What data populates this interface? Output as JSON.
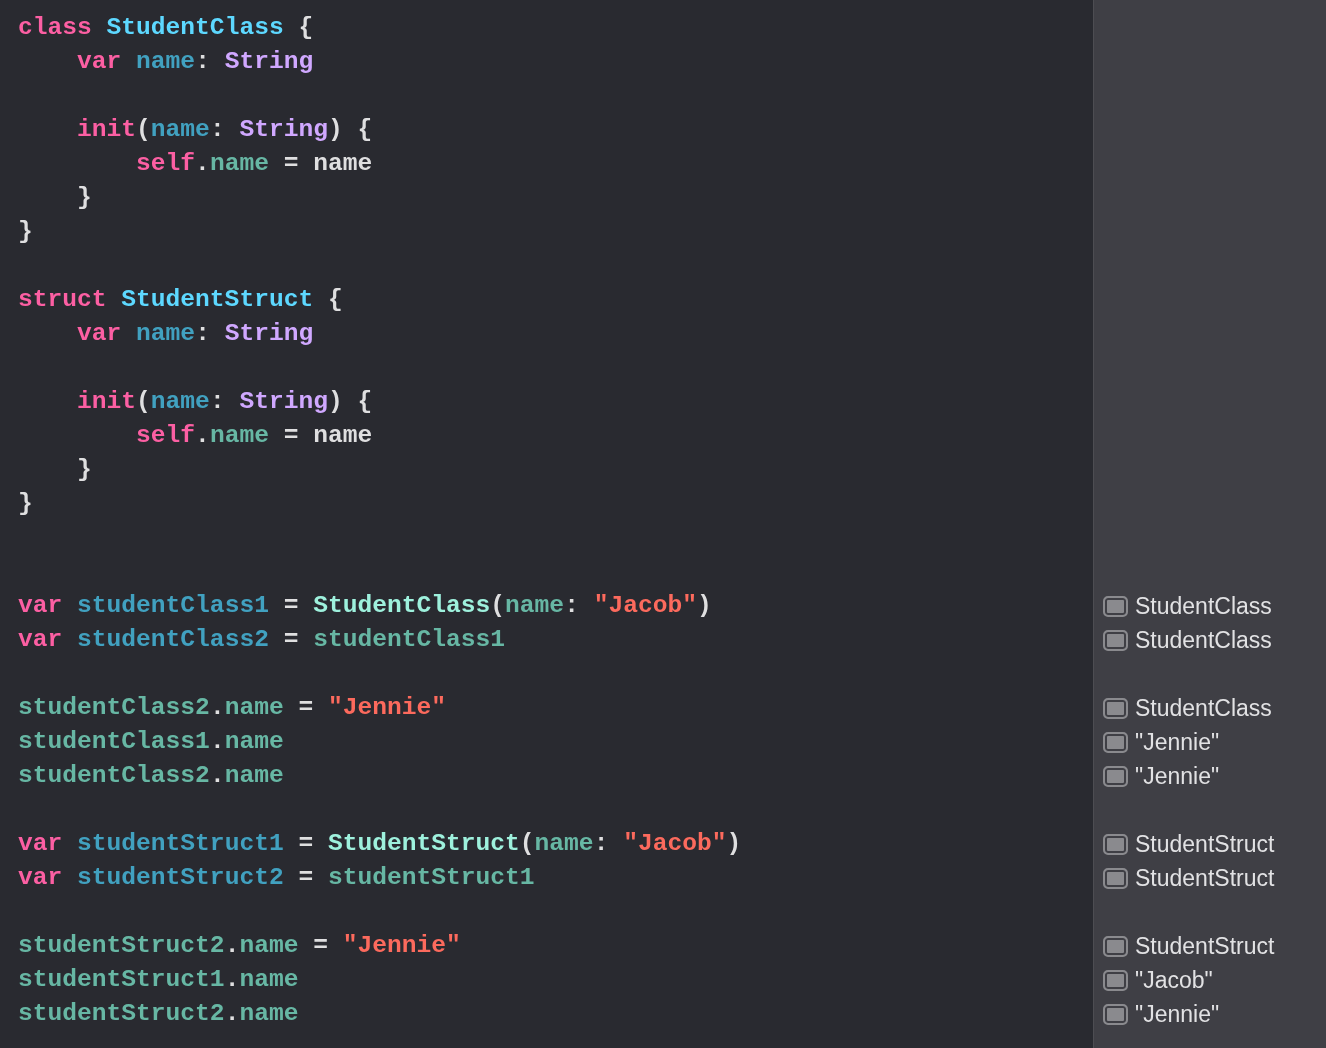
{
  "editor": {
    "lines": [
      {
        "kind": "code",
        "tokens": [
          {
            "text": "class ",
            "kind": "keyword"
          },
          {
            "text": "StudentClass",
            "kind": "typedecl"
          },
          {
            "text": " {",
            "kind": "plain"
          }
        ]
      },
      {
        "kind": "code",
        "tokens": [
          {
            "text": "    var ",
            "kind": "keyword"
          },
          {
            "text": "name",
            "kind": "decl"
          },
          {
            "text": ": ",
            "kind": "plain"
          },
          {
            "text": "String",
            "kind": "type"
          }
        ]
      },
      {
        "kind": "blank"
      },
      {
        "kind": "code",
        "tokens": [
          {
            "text": "    init",
            "kind": "keyword"
          },
          {
            "text": "(",
            "kind": "plain"
          },
          {
            "text": "name",
            "kind": "decl"
          },
          {
            "text": ": ",
            "kind": "plain"
          },
          {
            "text": "String",
            "kind": "type"
          },
          {
            "text": ") {",
            "kind": "plain"
          }
        ]
      },
      {
        "kind": "code",
        "tokens": [
          {
            "text": "        self",
            "kind": "keyword"
          },
          {
            "text": ".",
            "kind": "plain"
          },
          {
            "text": "name",
            "kind": "ref"
          },
          {
            "text": " = name",
            "kind": "plain"
          }
        ]
      },
      {
        "kind": "code",
        "tokens": [
          {
            "text": "    }",
            "kind": "plain"
          }
        ]
      },
      {
        "kind": "code",
        "tokens": [
          {
            "text": "}",
            "kind": "plain"
          }
        ]
      },
      {
        "kind": "blank"
      },
      {
        "kind": "code",
        "tokens": [
          {
            "text": "struct ",
            "kind": "keyword"
          },
          {
            "text": "StudentStruct",
            "kind": "typedecl"
          },
          {
            "text": " {",
            "kind": "plain"
          }
        ]
      },
      {
        "kind": "code",
        "tokens": [
          {
            "text": "    var ",
            "kind": "keyword"
          },
          {
            "text": "name",
            "kind": "decl"
          },
          {
            "text": ": ",
            "kind": "plain"
          },
          {
            "text": "String",
            "kind": "type"
          }
        ]
      },
      {
        "kind": "blank"
      },
      {
        "kind": "code",
        "tokens": [
          {
            "text": "    init",
            "kind": "keyword"
          },
          {
            "text": "(",
            "kind": "plain"
          },
          {
            "text": "name",
            "kind": "decl"
          },
          {
            "text": ": ",
            "kind": "plain"
          },
          {
            "text": "String",
            "kind": "type"
          },
          {
            "text": ") {",
            "kind": "plain"
          }
        ]
      },
      {
        "kind": "code",
        "tokens": [
          {
            "text": "        self",
            "kind": "keyword"
          },
          {
            "text": ".",
            "kind": "plain"
          },
          {
            "text": "name",
            "kind": "ref"
          },
          {
            "text": " = name",
            "kind": "plain"
          }
        ]
      },
      {
        "kind": "code",
        "tokens": [
          {
            "text": "    }",
            "kind": "plain"
          }
        ]
      },
      {
        "kind": "code",
        "tokens": [
          {
            "text": "}",
            "kind": "plain"
          }
        ]
      },
      {
        "kind": "blank"
      },
      {
        "kind": "blank"
      },
      {
        "kind": "code",
        "tokens": [
          {
            "text": "var ",
            "kind": "keyword"
          },
          {
            "text": "studentClass1",
            "kind": "decl"
          },
          {
            "text": " = ",
            "kind": "plain"
          },
          {
            "text": "StudentClass",
            "kind": "call"
          },
          {
            "text": "(",
            "kind": "plain"
          },
          {
            "text": "name",
            "kind": "ref"
          },
          {
            "text": ": ",
            "kind": "plain"
          },
          {
            "text": "\"Jacob\"",
            "kind": "string"
          },
          {
            "text": ")",
            "kind": "plain"
          }
        ],
        "result": "StudentClass"
      },
      {
        "kind": "code",
        "tokens": [
          {
            "text": "var ",
            "kind": "keyword"
          },
          {
            "text": "studentClass2",
            "kind": "decl"
          },
          {
            "text": " = ",
            "kind": "plain"
          },
          {
            "text": "studentClass1",
            "kind": "ref"
          }
        ],
        "result": "StudentClass"
      },
      {
        "kind": "blank"
      },
      {
        "kind": "code",
        "tokens": [
          {
            "text": "studentClass2",
            "kind": "ref"
          },
          {
            "text": ".",
            "kind": "plain"
          },
          {
            "text": "name",
            "kind": "ref"
          },
          {
            "text": " = ",
            "kind": "plain"
          },
          {
            "text": "\"Jennie\"",
            "kind": "string"
          }
        ],
        "result": "StudentClass"
      },
      {
        "kind": "code",
        "tokens": [
          {
            "text": "studentClass1",
            "kind": "ref"
          },
          {
            "text": ".",
            "kind": "plain"
          },
          {
            "text": "name",
            "kind": "ref"
          }
        ],
        "result": "\"Jennie\""
      },
      {
        "kind": "code",
        "tokens": [
          {
            "text": "studentClass2",
            "kind": "ref"
          },
          {
            "text": ".",
            "kind": "plain"
          },
          {
            "text": "name",
            "kind": "ref"
          }
        ],
        "result": "\"Jennie\""
      },
      {
        "kind": "blank"
      },
      {
        "kind": "code",
        "tokens": [
          {
            "text": "var ",
            "kind": "keyword"
          },
          {
            "text": "studentStruct1",
            "kind": "decl"
          },
          {
            "text": " = ",
            "kind": "plain"
          },
          {
            "text": "StudentStruct",
            "kind": "call"
          },
          {
            "text": "(",
            "kind": "plain"
          },
          {
            "text": "name",
            "kind": "ref"
          },
          {
            "text": ": ",
            "kind": "plain"
          },
          {
            "text": "\"Jacob\"",
            "kind": "string"
          },
          {
            "text": ")",
            "kind": "plain"
          }
        ],
        "result": "StudentStruct"
      },
      {
        "kind": "code",
        "tokens": [
          {
            "text": "var ",
            "kind": "keyword"
          },
          {
            "text": "studentStruct2",
            "kind": "decl"
          },
          {
            "text": " = ",
            "kind": "plain"
          },
          {
            "text": "studentStruct1",
            "kind": "ref"
          }
        ],
        "result": "StudentStruct"
      },
      {
        "kind": "blank"
      },
      {
        "kind": "code",
        "tokens": [
          {
            "text": "studentStruct2",
            "kind": "ref"
          },
          {
            "text": ".",
            "kind": "plain"
          },
          {
            "text": "name",
            "kind": "ref"
          },
          {
            "text": " = ",
            "kind": "plain"
          },
          {
            "text": "\"Jennie\"",
            "kind": "string"
          }
        ],
        "result": "StudentStruct"
      },
      {
        "kind": "code",
        "tokens": [
          {
            "text": "studentStruct1",
            "kind": "ref"
          },
          {
            "text": ".",
            "kind": "plain"
          },
          {
            "text": "name",
            "kind": "ref"
          }
        ],
        "result": "\"Jacob\""
      },
      {
        "kind": "code",
        "tokens": [
          {
            "text": "studentStruct2",
            "kind": "ref"
          },
          {
            "text": ".",
            "kind": "plain"
          },
          {
            "text": "name",
            "kind": "ref"
          }
        ],
        "result": "\"Jennie\""
      }
    ]
  }
}
